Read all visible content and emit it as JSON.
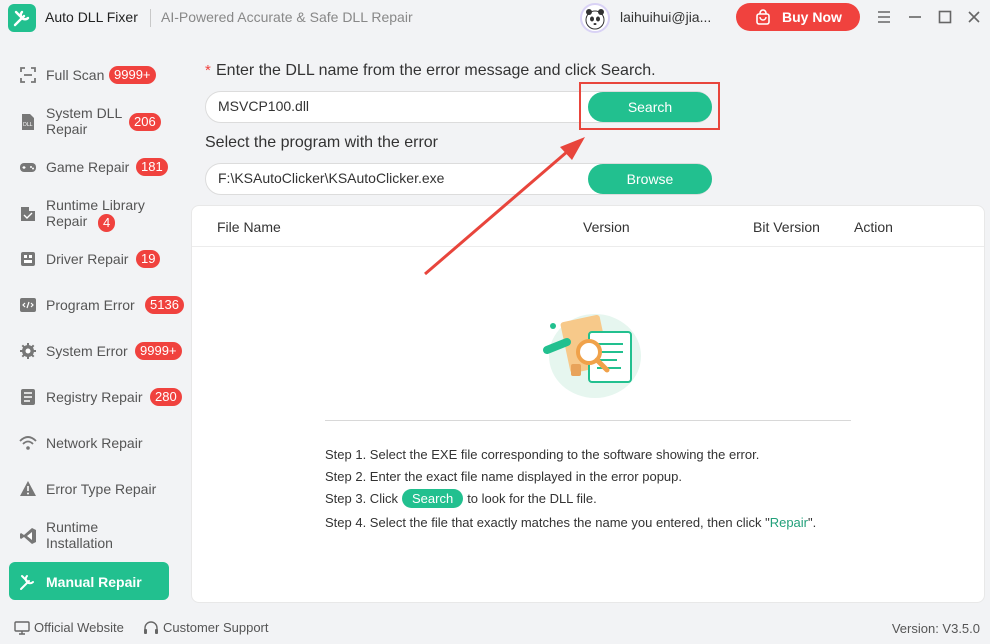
{
  "app": {
    "name": "Auto DLL Fixer",
    "tagline": "AI-Powered Accurate & Safe DLL Repair",
    "user": "laihuihui@jia...",
    "buy_label": "Buy Now"
  },
  "sidebar": {
    "items": [
      {
        "label": "Full Scan",
        "badge": "9999+",
        "icon": "scan-icon"
      },
      {
        "label": "System DLL Repair",
        "badge": "206",
        "icon": "dll-icon"
      },
      {
        "label": "Game Repair",
        "badge": "181",
        "icon": "gamepad-icon"
      },
      {
        "label": "Runtime Library Repair",
        "badge": "4",
        "icon": "runtime-library-icon"
      },
      {
        "label": "Driver Repair",
        "badge": "19",
        "icon": "driver-icon"
      },
      {
        "label": "Program Error",
        "badge": "5136",
        "icon": "code-icon"
      },
      {
        "label": "System Error",
        "badge": "9999+",
        "icon": "gear-icon"
      },
      {
        "label": "Registry Repair",
        "badge": "280",
        "icon": "list-icon"
      },
      {
        "label": "Network Repair",
        "badge": "",
        "icon": "wifi-icon"
      },
      {
        "label": "Error Type Repair",
        "badge": "",
        "icon": "warning-icon"
      },
      {
        "label": "Runtime Installation",
        "badge": "",
        "icon": "visual-studio-icon"
      },
      {
        "label": "Manual Repair",
        "badge": "",
        "icon": "tools-icon",
        "active": true
      }
    ]
  },
  "main": {
    "dll_label": "Enter the DLL name from the error message and click Search.",
    "dll_value": "MSVCP100.dll",
    "search_label": "Search",
    "program_label": "Select the program with the error",
    "program_value": "F:\\KSAutoClicker\\KSAutoClicker.exe",
    "browse_label": "Browse",
    "columns": [
      "File Name",
      "Version",
      "Bit Version",
      "Action"
    ],
    "steps": {
      "s1": "Step 1. Select the EXE file corresponding to the software showing the error.",
      "s2": "Step 2. Enter the exact file name displayed in the error popup.",
      "s3_pre": "Step 3. Click",
      "s3_btn": "Search",
      "s3_post": "to look for the DLL file.",
      "s4_pre": "Step 4. Select the file that exactly matches the name you entered, then click \"",
      "s4_link": "Repair",
      "s4_post": "\"."
    }
  },
  "footer": {
    "website": "Official Website",
    "support": "Customer Support",
    "version": "Version: V3.5.0"
  },
  "colors": {
    "accent": "#22c08f",
    "badge": "#f0423e",
    "annotation": "#e8453c"
  }
}
